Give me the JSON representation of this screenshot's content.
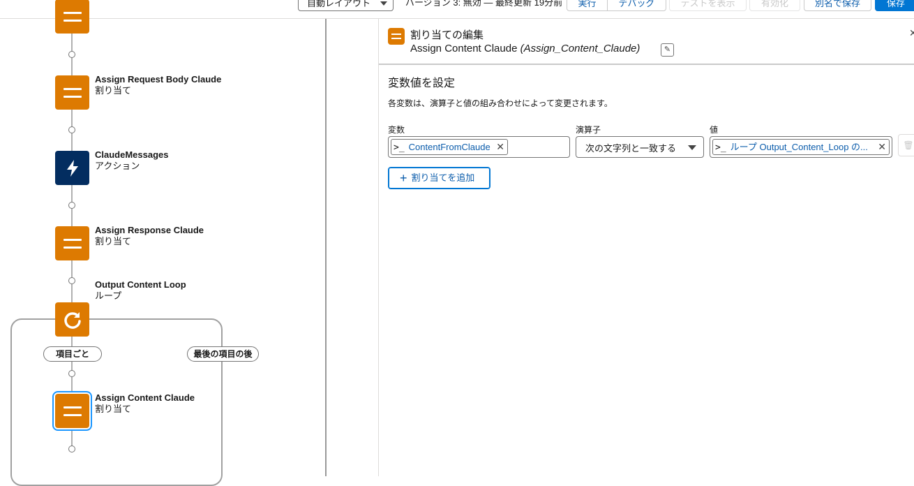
{
  "toolbar": {
    "layout_select": "自動レイアウト",
    "version_text": "バージョン 3: 無効 — 最終更新 19分前",
    "run_label": "実行",
    "debug_label": "デバッグ",
    "view_tests_label": "テストを表示",
    "activate_label": "有効化",
    "save_as_label": "別名で保存",
    "save_label": "保存"
  },
  "canvas": {
    "nodes": [
      {
        "title": "Assign Request Body Claude",
        "type": "割り当て",
        "icon": "assignment-icon"
      },
      {
        "title": "ClaudeMessages",
        "type": "アクション",
        "icon": "lightning-icon"
      },
      {
        "title": "Assign Response Claude",
        "type": "割り当て",
        "icon": "assignment-icon"
      },
      {
        "title": "Output Content Loop",
        "type": "ループ",
        "icon": "loop-icon"
      },
      {
        "title": "Assign Content Claude",
        "type": "割り当て",
        "icon": "assignment-icon"
      }
    ],
    "loop_for_each": "項目ごと",
    "loop_after_last": "最後の項目の後"
  },
  "panel": {
    "element_type": "割り当ての編集",
    "element_label": "Assign Content Claude",
    "element_api_name": "(Assign_Content_Claude)",
    "section_title": "変数値を設定",
    "section_description": "各変数は、演算子と値の組み合わせによって変更されます。",
    "variable_label": "変数",
    "operator_label": "演算子",
    "value_label": "値",
    "variable_value": "ContentFromClaude",
    "operator_value": "次の文字列と一致する",
    "value_value": "ループ Output_Content_Loop の...",
    "add_assignment_label": "割り当てを追加"
  },
  "colors": {
    "assignment": "#dd7a01",
    "action": "#032d60",
    "primary": "#0176d3",
    "selection": "#1b96ff"
  }
}
